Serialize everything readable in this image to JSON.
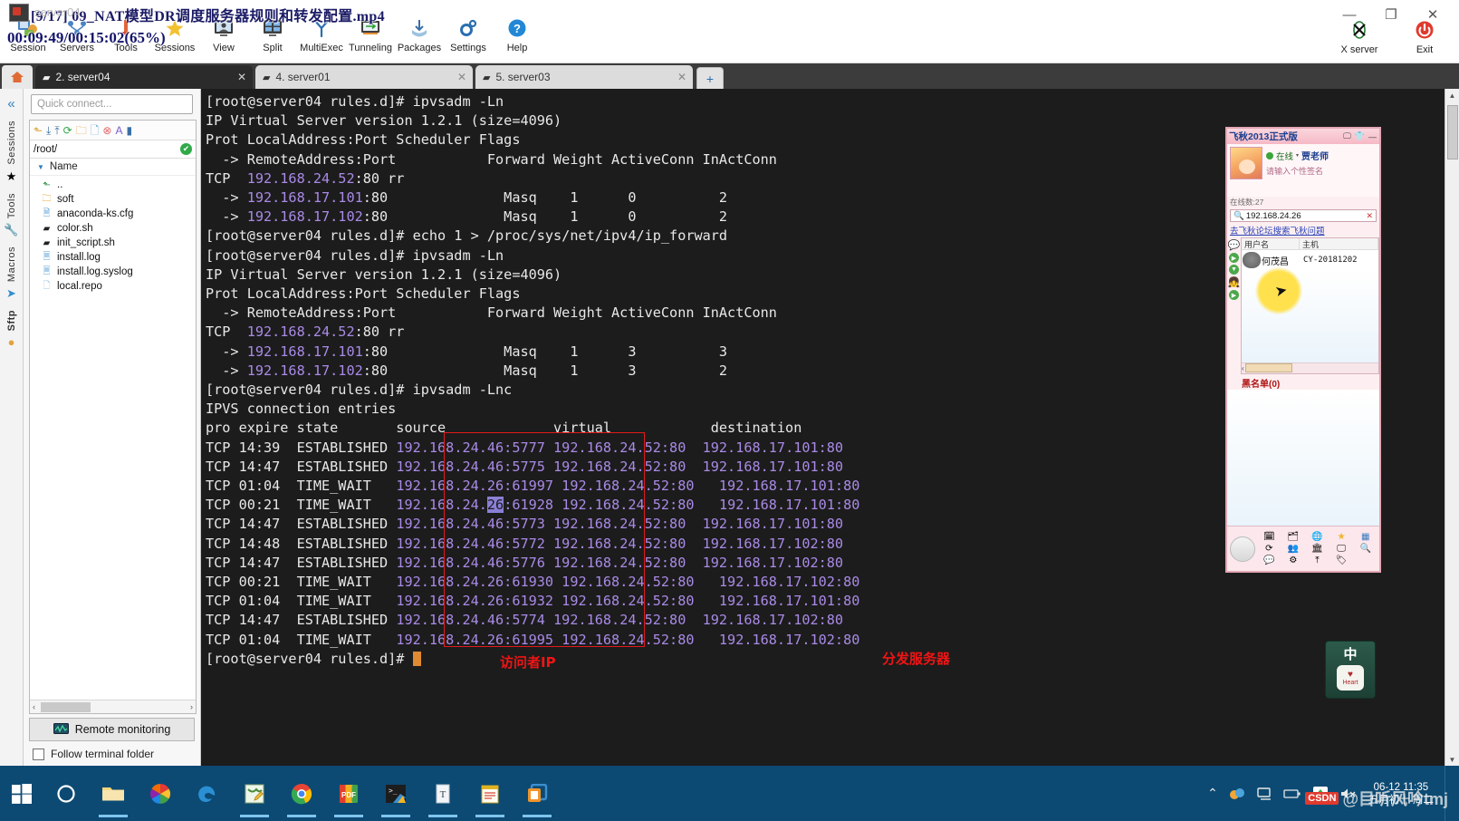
{
  "window": {
    "title": "server04",
    "controls": {
      "minimize": "—",
      "maximize": "❐",
      "close": "✕"
    }
  },
  "video_overlay": {
    "line1": "[9/17] 09_NAT模型DR调度服务器规则和转发配置.mp4",
    "line2": "00:09:49/00:15:02(65%)",
    "ghost_title": "server04"
  },
  "toolbar": {
    "items": [
      {
        "label": "Session",
        "icon": "session-icon"
      },
      {
        "label": "Servers",
        "icon": "servers-icon"
      },
      {
        "label": "Tools",
        "icon": "tools-icon"
      },
      {
        "label": "Sessions",
        "icon": "sessions-star-icon"
      },
      {
        "label": "View",
        "icon": "view-icon"
      },
      {
        "label": "Split",
        "icon": "split-icon"
      },
      {
        "label": "MultiExec",
        "icon": "multiexec-icon"
      },
      {
        "label": "Tunneling",
        "icon": "tunneling-icon"
      },
      {
        "label": "Packages",
        "icon": "packages-icon"
      },
      {
        "label": "Settings",
        "icon": "settings-gear-icon"
      },
      {
        "label": "Help",
        "icon": "help-icon"
      }
    ],
    "right": [
      {
        "label": "X server",
        "icon": "xserver-icon"
      },
      {
        "label": "Exit",
        "icon": "power-icon"
      }
    ]
  },
  "tabs": {
    "home_icon": "home-icon",
    "items": [
      {
        "label": "2. server04",
        "active": true
      },
      {
        "label": "4. server01",
        "active": false
      },
      {
        "label": "5. server03",
        "active": false
      }
    ],
    "new_tab": "+"
  },
  "rail": {
    "collapse": "«",
    "groups": [
      {
        "label": "Sessions",
        "icon": "star-icon"
      },
      {
        "label": "Tools",
        "icon": "wrench-icon"
      },
      {
        "label": "Macros",
        "icon": "paper-plane-icon"
      },
      {
        "label": "Sftp",
        "icon": "globe-icon"
      }
    ]
  },
  "sftp": {
    "quick_connect_placeholder": "Quick connect...",
    "path": "/root/",
    "path_ok": "✔",
    "column_header": "Name",
    "files": [
      {
        "name": "..",
        "icon": "parent-folder-icon"
      },
      {
        "name": "soft",
        "icon": "folder-icon"
      },
      {
        "name": "anaconda-ks.cfg",
        "icon": "config-file-icon"
      },
      {
        "name": "color.sh",
        "icon": "shell-script-icon"
      },
      {
        "name": "init_script.sh",
        "icon": "shell-script-icon"
      },
      {
        "name": "install.log",
        "icon": "log-file-icon"
      },
      {
        "name": "install.log.syslog",
        "icon": "log-file-icon"
      },
      {
        "name": "local.repo",
        "icon": "file-icon"
      }
    ],
    "remote_monitoring": "Remote monitoring",
    "follow_terminal_folder": "Follow terminal folder",
    "scroll_left": "‹",
    "scroll_right": "›"
  },
  "terminal": {
    "prompt": "[root@server04 rules.d]# ",
    "lines": [
      {
        "segs": [
          {
            "t": "[root@server04 rules.d]# ipvsadm -Ln",
            "c": "w"
          }
        ]
      },
      {
        "segs": [
          {
            "t": "IP Virtual Server version 1.2.1 (size=4096)",
            "c": "w"
          }
        ]
      },
      {
        "segs": [
          {
            "t": "Prot LocalAddress:Port Scheduler Flags",
            "c": "w"
          }
        ]
      },
      {
        "segs": [
          {
            "t": "  -> RemoteAddress:Port           Forward Weight ActiveConn InActConn",
            "c": "w"
          }
        ]
      },
      {
        "segs": [
          {
            "t": "TCP  ",
            "c": "w"
          },
          {
            "t": "192.168.24.52",
            "c": "p"
          },
          {
            "t": ":80 rr",
            "c": "w"
          }
        ]
      },
      {
        "segs": [
          {
            "t": "  -> ",
            "c": "w"
          },
          {
            "t": "192.168.17.101",
            "c": "p"
          },
          {
            "t": ":80              Masq    1      0          2",
            "c": "w"
          }
        ]
      },
      {
        "segs": [
          {
            "t": "  -> ",
            "c": "w"
          },
          {
            "t": "192.168.17.102",
            "c": "p"
          },
          {
            "t": ":80              Masq    1      0          2",
            "c": "w"
          }
        ]
      },
      {
        "segs": [
          {
            "t": "[root@server04 rules.d]# echo 1 > /proc/sys/net/ipv4/ip_forward",
            "c": "w"
          }
        ]
      },
      {
        "segs": [
          {
            "t": "[root@server04 rules.d]# ipvsadm -Ln",
            "c": "w"
          }
        ]
      },
      {
        "segs": [
          {
            "t": "IP Virtual Server version 1.2.1 (size=4096)",
            "c": "w"
          }
        ]
      },
      {
        "segs": [
          {
            "t": "Prot LocalAddress:Port Scheduler Flags",
            "c": "w"
          }
        ]
      },
      {
        "segs": [
          {
            "t": "  -> RemoteAddress:Port           Forward Weight ActiveConn InActConn",
            "c": "w"
          }
        ]
      },
      {
        "segs": [
          {
            "t": "TCP  ",
            "c": "w"
          },
          {
            "t": "192.168.24.52",
            "c": "p"
          },
          {
            "t": ":80 rr",
            "c": "w"
          }
        ]
      },
      {
        "segs": [
          {
            "t": "  -> ",
            "c": "w"
          },
          {
            "t": "192.168.17.101",
            "c": "p"
          },
          {
            "t": ":80              Masq    1      3          3",
            "c": "w"
          }
        ]
      },
      {
        "segs": [
          {
            "t": "  -> ",
            "c": "w"
          },
          {
            "t": "192.168.17.102",
            "c": "p"
          },
          {
            "t": ":80              Masq    1      3          2",
            "c": "w"
          }
        ]
      },
      {
        "segs": [
          {
            "t": "[root@server04 rules.d]# ipvsadm -Lnc",
            "c": "w"
          }
        ]
      },
      {
        "segs": [
          {
            "t": "IPVS connection entries",
            "c": "w"
          }
        ]
      },
      {
        "segs": [
          {
            "t": "pro expire state       source             virtual            destination",
            "c": "w"
          }
        ]
      },
      {
        "segs": [
          {
            "t": "TCP 14:39  ESTABLISHED ",
            "c": "w"
          },
          {
            "t": "192.168.24.46:5777 192.168.24.52:80  192.168.17.101:80",
            "c": "p"
          }
        ]
      },
      {
        "segs": [
          {
            "t": "TCP 14:47  ESTABLISHED ",
            "c": "w"
          },
          {
            "t": "192.168.24.46:5775 192.168.24.52:80  192.168.17.101:80",
            "c": "p"
          }
        ]
      },
      {
        "segs": [
          {
            "t": "TCP 01:04  TIME_WAIT   ",
            "c": "w"
          },
          {
            "t": "192.168.24.26:61997 192.168.24.52:80   192.168.17.101:80",
            "c": "p"
          }
        ]
      },
      {
        "segs": [
          {
            "t": "TCP 00:21  TIME_WAIT   ",
            "c": "w"
          },
          {
            "t": "192.168.24.",
            "c": "p"
          },
          {
            "t": "26",
            "c": "h"
          },
          {
            "t": ":61928 192.168.24.52:80   192.168.17.101:80",
            "c": "p"
          }
        ]
      },
      {
        "segs": [
          {
            "t": "TCP 14:47  ESTABLISHED ",
            "c": "w"
          },
          {
            "t": "192.168.24.46:5773 192.168.24.52:80  192.168.17.101:80",
            "c": "p"
          }
        ]
      },
      {
        "segs": [
          {
            "t": "TCP 14:48  ESTABLISHED ",
            "c": "w"
          },
          {
            "t": "192.168.24.46:5772 192.168.24.52:80  192.168.17.102:80",
            "c": "p"
          }
        ]
      },
      {
        "segs": [
          {
            "t": "TCP 14:47  ESTABLISHED ",
            "c": "w"
          },
          {
            "t": "192.168.24.46:5776 192.168.24.52:80  192.168.17.102:80",
            "c": "p"
          }
        ]
      },
      {
        "segs": [
          {
            "t": "TCP 00:21  TIME_WAIT   ",
            "c": "w"
          },
          {
            "t": "192.168.24.26:61930 192.168.24.52:80   192.168.17.102:80",
            "c": "p"
          }
        ]
      },
      {
        "segs": [
          {
            "t": "TCP 01:04  TIME_WAIT   ",
            "c": "w"
          },
          {
            "t": "192.168.24.26:61932 192.168.24.52:80   192.168.17.101:80",
            "c": "p"
          }
        ]
      },
      {
        "segs": [
          {
            "t": "TCP 14:47  ESTABLISHED ",
            "c": "w"
          },
          {
            "t": "192.168.24.46:5774 192.168.24.52:80  192.168.17.102:80",
            "c": "p"
          }
        ]
      },
      {
        "segs": [
          {
            "t": "TCP 01:04  TIME_WAIT   ",
            "c": "w"
          },
          {
            "t": "192.168.24.26:61995 192.168.24.52:80   192.168.17.102:80",
            "c": "p"
          }
        ]
      }
    ],
    "last_prompt": "[root@server04 rules.d]# ",
    "colors": {
      "background": "#1c1c1c",
      "foreground": "#e8e8e8",
      "ip_purple": "#a98ae6",
      "cursor": "#e08a33",
      "highlight": "#8a7fd6"
    }
  },
  "annotations": {
    "color": "#f01414",
    "source_label": "访问者IP",
    "dest_label": "分发服务器"
  },
  "feiqiu": {
    "title": "飞秋2013正式版",
    "min_btn": "—",
    "status": "在线",
    "status_caret": "▾",
    "user": "贾老师",
    "signature": "请输入个性签名",
    "online_count": "在线数:27",
    "search_value": "192.168.24.26",
    "search_icon": "search-icon",
    "search_clear": "✕",
    "forum_link": "去飞秋论坛搜索飞秋问题",
    "columns": {
      "user": "用户名",
      "host": "主机"
    },
    "contact": {
      "name": "何茂昌",
      "host": "CY-20181202",
      "avatar": "cat-avatar-icon"
    },
    "blacklist": "黑名单(0)",
    "scroll_left": "‹",
    "scroll_right": "›",
    "bottom_icons": [
      "calendar-icon",
      "folder-icon",
      "globe-star-icon",
      "star-icon",
      "grid-icon",
      "refresh-icon",
      "group-icon",
      "bank-icon",
      "monitor-icon",
      "search-icon",
      "chat-icon",
      "settings-icon",
      "upload-icon",
      "tag-icon"
    ]
  },
  "ime": {
    "mode": "中",
    "brand": "Heart"
  },
  "taskbar": {
    "start": "start-icon",
    "apps": [
      {
        "icon": "cortana-icon",
        "name": "cortana",
        "running": false
      },
      {
        "icon": "file-explorer-icon",
        "name": "file-explorer",
        "running": true
      },
      {
        "icon": "pinwheel-icon",
        "name": "pinwheel-app",
        "running": false
      },
      {
        "icon": "edge-icon",
        "name": "edge",
        "running": false
      },
      {
        "icon": "notepad-plus-icon",
        "name": "editor",
        "running": true
      },
      {
        "icon": "chrome-icon",
        "name": "chrome",
        "running": true
      },
      {
        "icon": "pdf-icon",
        "name": "pdf-reader",
        "running": true
      },
      {
        "icon": "terminal-icon",
        "name": "mobaxterm",
        "running": true
      },
      {
        "icon": "text-icon",
        "name": "text-app",
        "running": true
      },
      {
        "icon": "notes-icon",
        "name": "notes-app",
        "running": true
      },
      {
        "icon": "vmware-icon",
        "name": "vmware",
        "running": true
      }
    ],
    "tray": {
      "chevron": "⌃",
      "icons": [
        "cloud-icon",
        "network-icon",
        "battery-icon",
        "update-icon",
        "volume-muted-icon"
      ],
      "volume_muted": "🔇"
    },
    "clock": {
      "time": "06-12 11:35",
      "date": "五月初十 周二"
    }
  },
  "watermark": {
    "badge": "CSDN",
    "text": "@目听风吟tmj"
  }
}
